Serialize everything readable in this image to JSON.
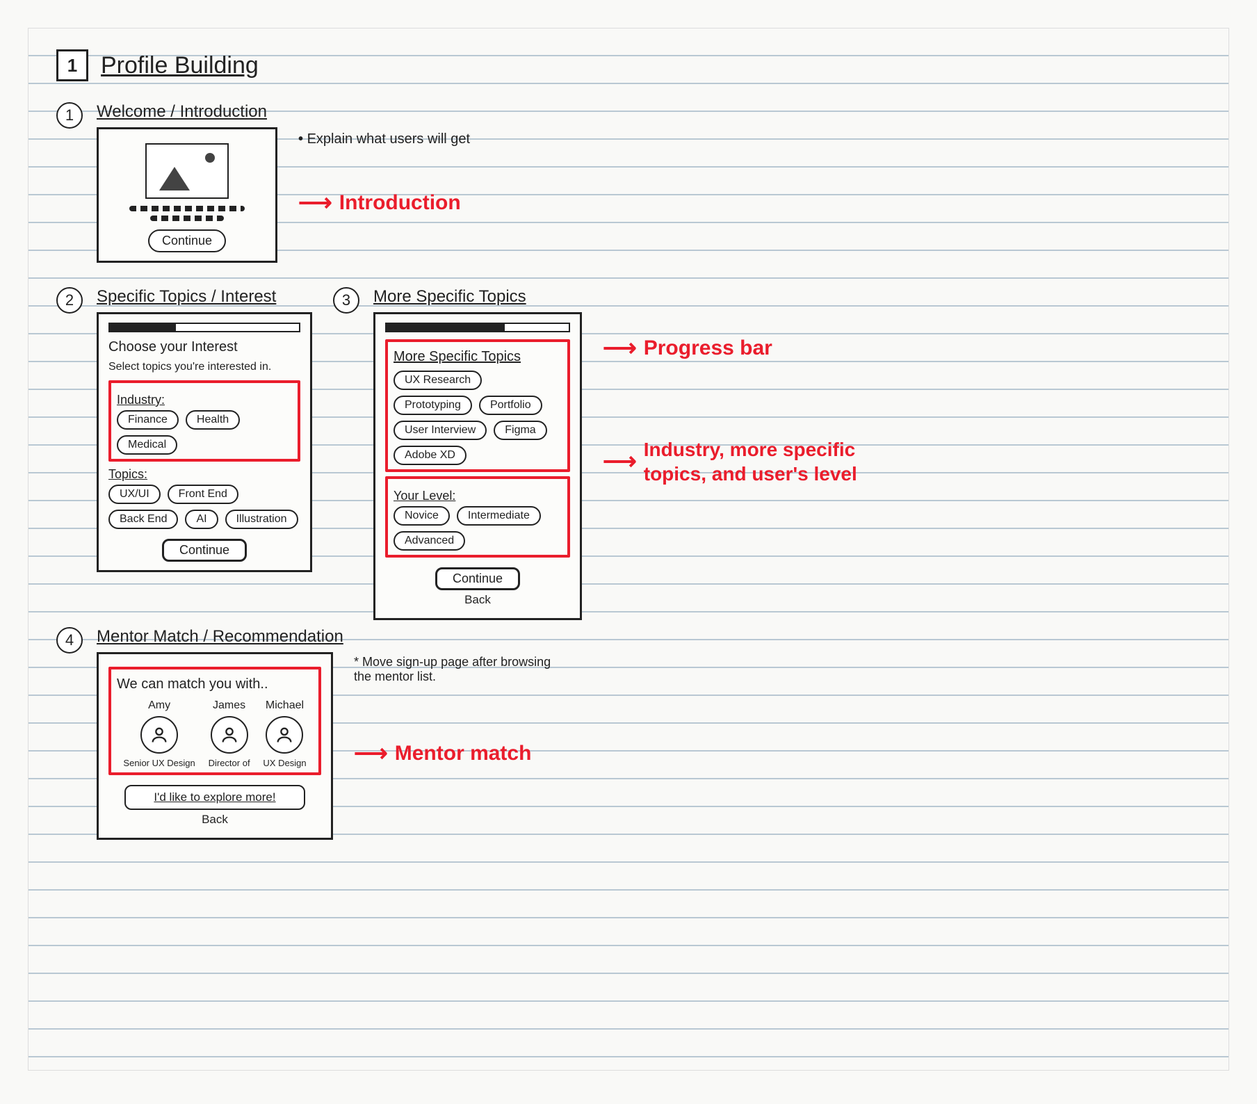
{
  "page": {
    "number": "1",
    "title": "Profile Building"
  },
  "sections": {
    "s1": {
      "num": "1",
      "title": "Welcome / Introduction"
    },
    "s2": {
      "num": "2",
      "title": "Specific Topics / Interest"
    },
    "s3": {
      "num": "3",
      "title": "More Specific Topics"
    },
    "s4": {
      "num": "4",
      "title": "Mentor Match / Recommendation"
    }
  },
  "welcome": {
    "continue_label": "Continue",
    "note": "Explain what users will get"
  },
  "annotations": {
    "introduction": "Introduction",
    "progress_bar": "Progress bar",
    "industry_levels": "Industry, more specific topics, and user's level",
    "mentor_match": "Mentor match"
  },
  "interest": {
    "progress_pct": 35,
    "heading": "Choose your Interest",
    "hint": "Select topics you're interested in.",
    "industry_label": "Industry:",
    "industry_chips": [
      "Finance",
      "Health",
      "Medical"
    ],
    "topics_label": "Topics:",
    "topics_chips": [
      "UX/UI",
      "Front End",
      "Back End",
      "AI",
      "Illustration"
    ],
    "continue_label": "Continue"
  },
  "more_topics": {
    "progress_pct": 65,
    "heading": "More Specific Topics",
    "chips": [
      "UX Research",
      "Prototyping",
      "Portfolio",
      "User Interview",
      "Figma",
      "Adobe XD"
    ],
    "level_label": "Your Level:",
    "level_chips": [
      "Novice",
      "Intermediate",
      "Advanced"
    ],
    "continue_label": "Continue",
    "back_label": "Back"
  },
  "mentor": {
    "heading": "We can match you with..",
    "mentors": [
      {
        "name": "Amy",
        "role": "Senior UX Design"
      },
      {
        "name": "James",
        "role": "Director of"
      },
      {
        "name": "Michael",
        "role": "UX Design"
      }
    ],
    "explore_label": "I'd like to explore more!",
    "back_label": "Back",
    "footnote": "Move sign-up page after browsing the mentor list."
  }
}
